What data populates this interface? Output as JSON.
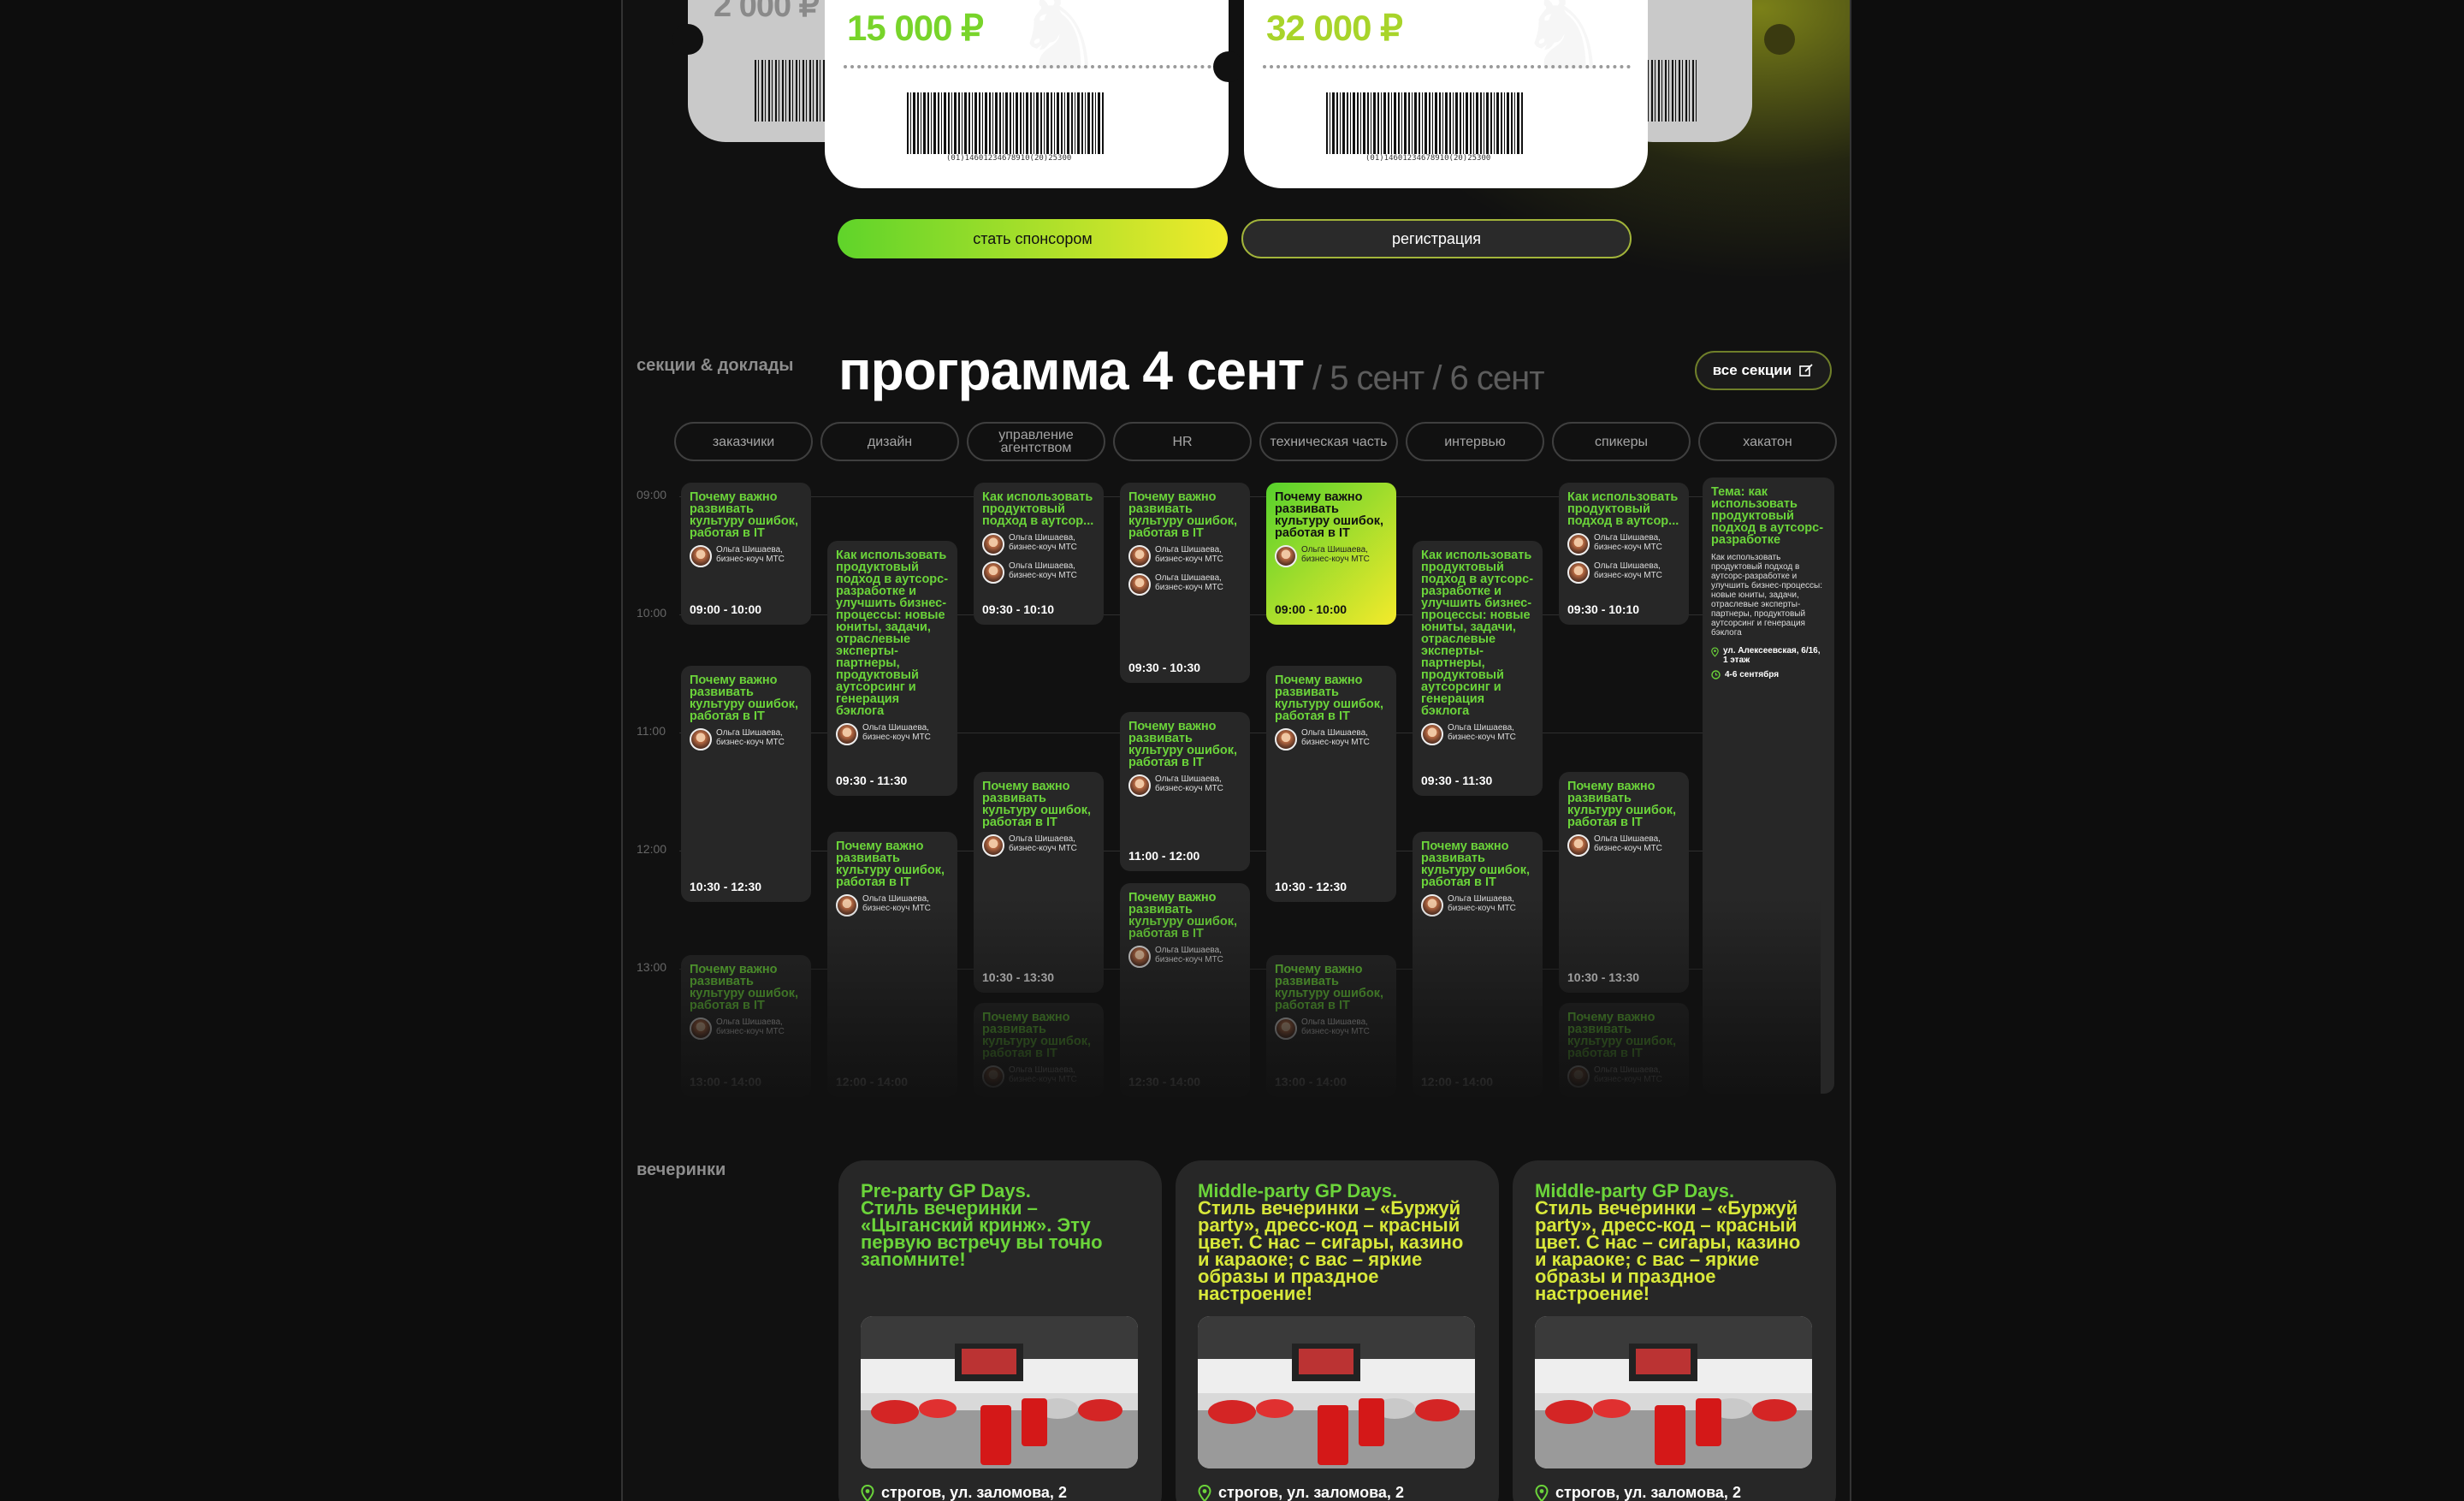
{
  "tickets": {
    "left_partial_price": "2 000 ₽",
    "price_1": "15 000 ₽",
    "price_2": "32 000 ₽",
    "barcode_number": "(01)14601234678910(20)25300"
  },
  "buttons": {
    "sponsor": "стать спонсором",
    "register": "регистрация"
  },
  "program": {
    "section_label": "секции & доклады",
    "title": "программа 4 сент",
    "alt_days": "/ 5 сент / 6 сент",
    "all_sections": "все секции",
    "tabs": [
      "заказчики",
      "дизайн",
      "управление агентством",
      "HR",
      "техническая часть",
      "интервью",
      "спикеры",
      "хакатон"
    ],
    "hours": [
      "09:00",
      "10:00",
      "11:00",
      "12:00",
      "13:00"
    ],
    "speaker": "Ольга Шишаева, бизнес-коуч МТС",
    "card_titles": {
      "culture": "Почему важно развивать культуру ошибок, работая в IT",
      "product_short": "Как использовать продуктовый подход в аутсор...",
      "product_long": "Как использовать продуктовый подход в аутсорс-разработке и улучшить бизнес-процессы: новые юниты, задачи, отраслевые эксперты-партнеры, продуктовый аутсорсинг и генерация бэклога"
    },
    "times": {
      "t1": "09:00 - 10:00",
      "t2": "10:30 - 12:30",
      "t3": "13:00 - 14:00",
      "t4": "09:30 - 11:30",
      "t5": "12:00 - 14:00",
      "t6": "09:30 - 10:10",
      "t7": "10:30 - 13:30",
      "t8": "09:30 - 10:30",
      "t9": "11:00 - 12:00",
      "t10": "12:30 - 14:00"
    },
    "hackathon": {
      "title": "Тема: как использовать продуктовый подход в аутсорс-разработке",
      "description": "Как использовать продуктовый подход в аутсорс-разработке и улучшить бизнес-процессы: новые юниты, задачи, отраслевые эксперты-партнеры, продуктовый аутсорсинг и генерация бэклога",
      "address": "ул. Алексеевская, 6/16, 1 этаж",
      "dates": "4-6 сентября"
    }
  },
  "parties": {
    "section_label": "вечеринки",
    "items": [
      {
        "title_a": "Pre-party GP Days.",
        "title_b": "Стиль вечеринки – «Цыганский кринж». Эту первую встречу вы точно запомните!",
        "location": "строгов, ул. заломова, 2"
      },
      {
        "title_a": "Middle-party GP Days.",
        "title_b": "Стиль вечеринки – «Буржуй party», дресс-код – красный цвет. С нас – сигары, казино и караоке; с вас – яркие образы и праздное настроение!",
        "location": "строгов, ул. заломова, 2"
      },
      {
        "title_a": "Middle-party GP Days.",
        "title_b": "Стиль вечеринки – «Буржуй party», дресс-код – красный цвет. С нас – сигары, казино и караоке; с вас – яркие образы и праздное настроение!",
        "location": "строгов, ул. заломова, 2"
      }
    ]
  },
  "colors": {
    "accent_green": "#6bd43a",
    "accent_yellow": "#f0ea2a",
    "card_bg": "#272727"
  }
}
